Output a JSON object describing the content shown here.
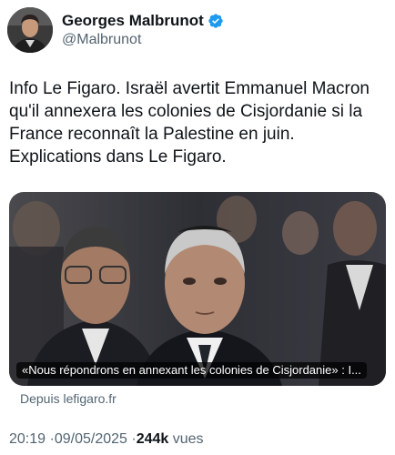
{
  "author": {
    "name": "Georges Malbrunot",
    "handle": "@Malbrunot",
    "verified_icon": "verified-badge-icon",
    "verified_color": "#1d9bf0"
  },
  "tweet": {
    "text": "Info Le Figaro. Israël avertit Emmanuel Macron qu'il annexera les colonies de Cisjordanie si la France reconnaît la Palestine en juin. Explications dans Le Figaro."
  },
  "link_card": {
    "caption": "«Nous répondrons en annexant les colonies de Cisjordanie» : I...",
    "source": "Depuis lefigaro.fr"
  },
  "meta": {
    "time": "20:19",
    "separator": "·",
    "date": "09/05/2025",
    "views_count": "244k",
    "views_label": "vues"
  }
}
